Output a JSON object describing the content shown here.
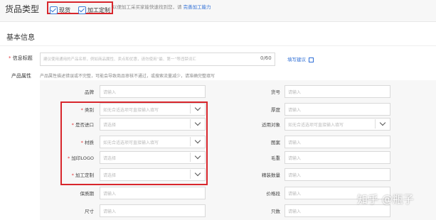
{
  "header": {
    "title": "货品类型",
    "options": [
      {
        "label": "现货",
        "checked": true
      },
      {
        "label": "加工定制",
        "checked": true
      }
    ],
    "hint_prefix": "以便加工采买家能快速找到您，请",
    "hint_link": "完善加工能力"
  },
  "section": {
    "title": "基本信息"
  },
  "info_title": {
    "label": "信息标题",
    "placeholder": "建议使用通用的产品名称，例如商品属性、卖点和优惠，请勿使用“最、第一”等违禁词汇",
    "counter": "0/60",
    "suggest_link": "填写建议"
  },
  "product_props": {
    "label": "产品属性",
    "hint": "产品属性描述错误或不完整，可能会导致商品审核不通过，或搜索流量减少，请准确完整填写"
  },
  "left_fields": [
    {
      "label": "品牌",
      "required": false,
      "placeholder": "请输入",
      "dropdown": false
    },
    {
      "label": "类别",
      "required": true,
      "placeholder": "如无合适选项可直接输入填写",
      "dropdown": true
    },
    {
      "label": "是否进口",
      "required": true,
      "placeholder": "请选择",
      "dropdown": true
    },
    {
      "label": "材质",
      "required": true,
      "placeholder": "如无合适选项可直接输入填写",
      "dropdown": true
    },
    {
      "label": "加印LOGO",
      "required": true,
      "placeholder": "请选择",
      "dropdown": true
    },
    {
      "label": "加工定制",
      "required": true,
      "placeholder": "请选择",
      "dropdown": true
    },
    {
      "label": "保质期",
      "required": false,
      "placeholder": "请输入",
      "dropdown": false
    },
    {
      "label": "尺寸",
      "required": false,
      "placeholder": "请输入",
      "dropdown": false
    }
  ],
  "right_fields": [
    {
      "label": "货号",
      "placeholder": "请输入",
      "dropdown": false
    },
    {
      "label": "厚度",
      "placeholder": "请输入",
      "dropdown": false
    },
    {
      "label": "适用对象",
      "placeholder": "如无合适选项可直接输入填写",
      "dropdown": true
    },
    {
      "label": "图案",
      "placeholder": "请输入",
      "dropdown": false
    },
    {
      "label": "毛重",
      "placeholder": "请输入",
      "dropdown": false
    },
    {
      "label": "精装数量",
      "placeholder": "请输入",
      "dropdown": false
    },
    {
      "label": "价格段",
      "placeholder": "请输入",
      "dropdown": false
    },
    {
      "label": "只数",
      "placeholder": "请输入",
      "dropdown": false
    }
  ],
  "watermark": "知乎 @瓶子",
  "colors": {
    "required": "#e4393c",
    "highlight": "#d8262c",
    "link": "#2f6fd6"
  }
}
